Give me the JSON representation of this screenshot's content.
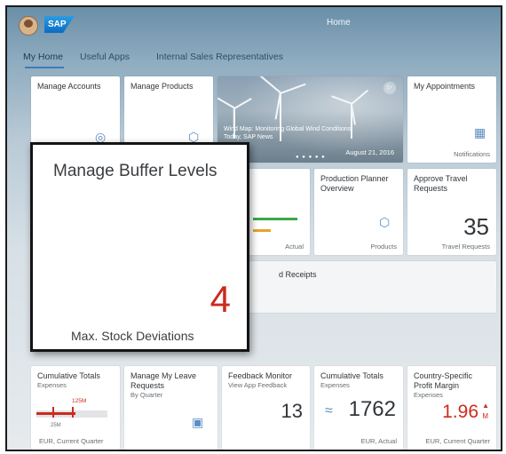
{
  "shell": {
    "logo_text": "SAP",
    "title": "Home"
  },
  "tabs": [
    {
      "label": "My Home"
    },
    {
      "label": "Useful Apps"
    },
    {
      "label": "Internal Sales Representatives"
    }
  ],
  "tiles": {
    "manage_accounts": {
      "title": "Manage Accounts",
      "icon": "target-icon"
    },
    "manage_products": {
      "title": "Manage Products",
      "icon": "box-icon"
    },
    "news": {
      "headline": "Wind Map: Monitoring Global Wind Conditions",
      "source": "Today, SAP News",
      "date": "August 21, 2016",
      "play_glyph": "▷"
    },
    "appointments": {
      "title": "My Appointments",
      "footer": "Notifications",
      "icon": "calendar-icon"
    },
    "production_planner": {
      "title": "Production Planner Overview",
      "footer": "Products",
      "icon": "box-icon"
    },
    "approve_travel": {
      "title": "Approve Travel Requests",
      "value": "35",
      "footer": "Travel Requests"
    },
    "hidden_kpi": {
      "footer": "Actual"
    },
    "receipts": {
      "title": "d Receipts"
    },
    "buffer": {
      "title": "Manage Buffer Levels",
      "value": "4",
      "footer": "Max. Stock Deviations"
    },
    "cumulative_1": {
      "title": "Cumulative Totals",
      "subtitle": "Expenses",
      "bar_value_label": "125M",
      "target_label": "25M",
      "footer": "EUR, Current Quarter",
      "bar_fill": 0.55
    },
    "leave": {
      "title": "Manage My Leave Requests",
      "subtitle": "By Quarter",
      "icon": "person-icon"
    },
    "feedback": {
      "title": "Feedback Monitor",
      "subtitle": "View App Feedback",
      "value": "13"
    },
    "cumulative_2": {
      "title": "Cumulative Totals",
      "subtitle": "Expenses",
      "value": "1762",
      "footer": "EUR, Actual",
      "trend_glyph": "≈"
    },
    "profit": {
      "title": "Country-Specific Profit Margin",
      "subtitle": "Expenses",
      "value": "1.96",
      "unit": "M",
      "footer": "EUR, Current Quarter",
      "arrow_glyph": "▲"
    }
  },
  "colors": {
    "accent": "#3b7bbd",
    "negative": "#cc2b1e",
    "positive": "#3aa844",
    "warning": "#e7a32b"
  }
}
